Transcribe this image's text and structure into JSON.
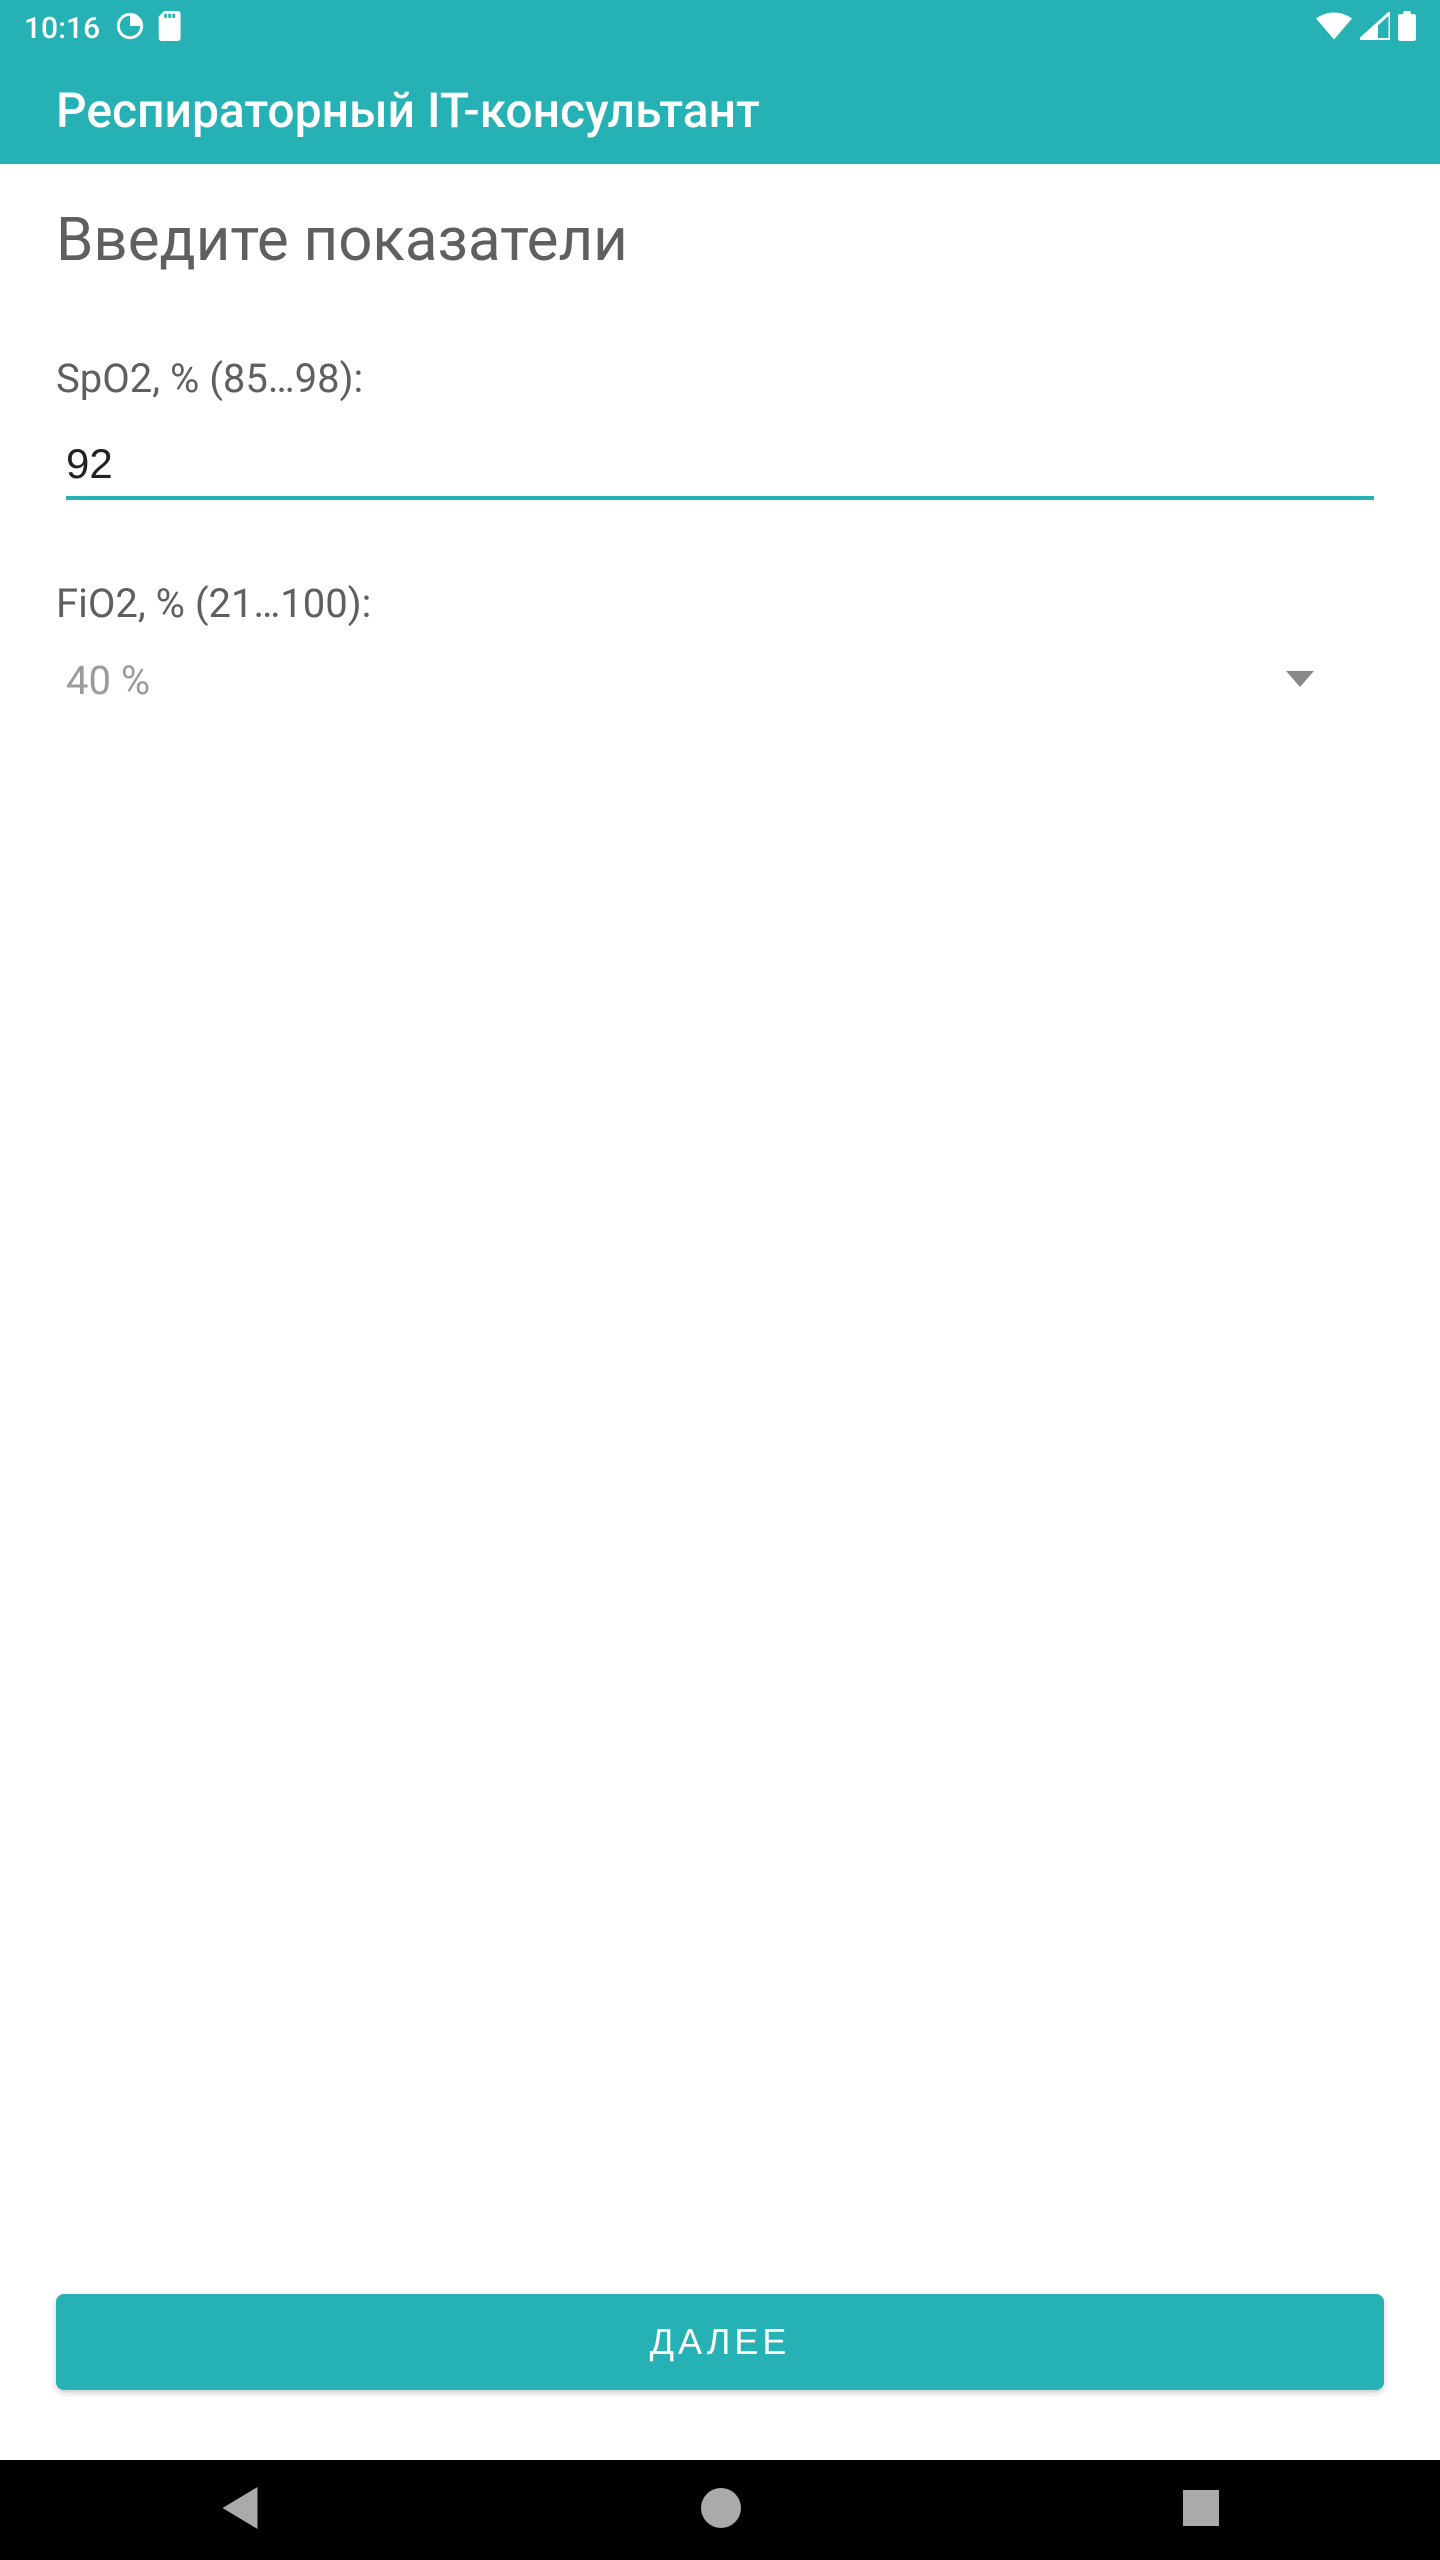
{
  "status_bar": {
    "time": "10:16"
  },
  "app_bar": {
    "title": "Респираторный IT-консультант"
  },
  "page": {
    "heading": "Введите показатели"
  },
  "fields": {
    "spo2": {
      "label": "SpO2, % (85…98):",
      "value": "92"
    },
    "fio2": {
      "label": "FiO2, % (21…100):",
      "selected": "40 %"
    }
  },
  "buttons": {
    "next": "ДАЛЕЕ"
  }
}
